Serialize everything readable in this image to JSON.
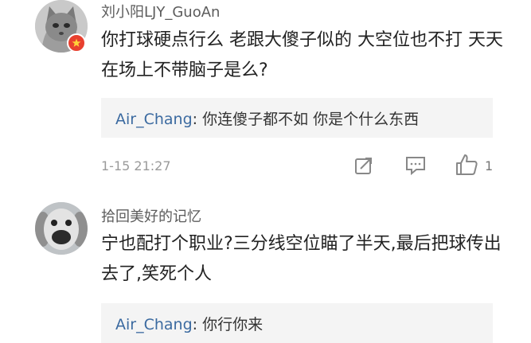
{
  "comments": [
    {
      "username": "刘小阳LJY_GuoAn",
      "text": "你打球硬点行么 老跟大傻子似的 大空位也不打 天天在场上不带脑子是么?",
      "reply": {
        "name": "Air_Chang",
        "sep": ":",
        "text": " 你连傻子都不如 你是个什么东西"
      },
      "timestamp": "1-15 21:27",
      "like_count": "1",
      "icons": [
        "share-icon",
        "comment-icon",
        "thumbs-up-icon"
      ]
    },
    {
      "username": "拾回美好的记忆",
      "text": "宁也配打个职业?三分线空位瞄了半天,最后把球传出去了,笑死个人",
      "reply": {
        "name": "Air_Chang",
        "sep": ":",
        "text": " 你行你来"
      }
    }
  ],
  "colors": {
    "username": "#5c5c5c",
    "reply_name": "#3b6aa0",
    "badge": "#e8402f",
    "meta": "#9a9a9a"
  }
}
